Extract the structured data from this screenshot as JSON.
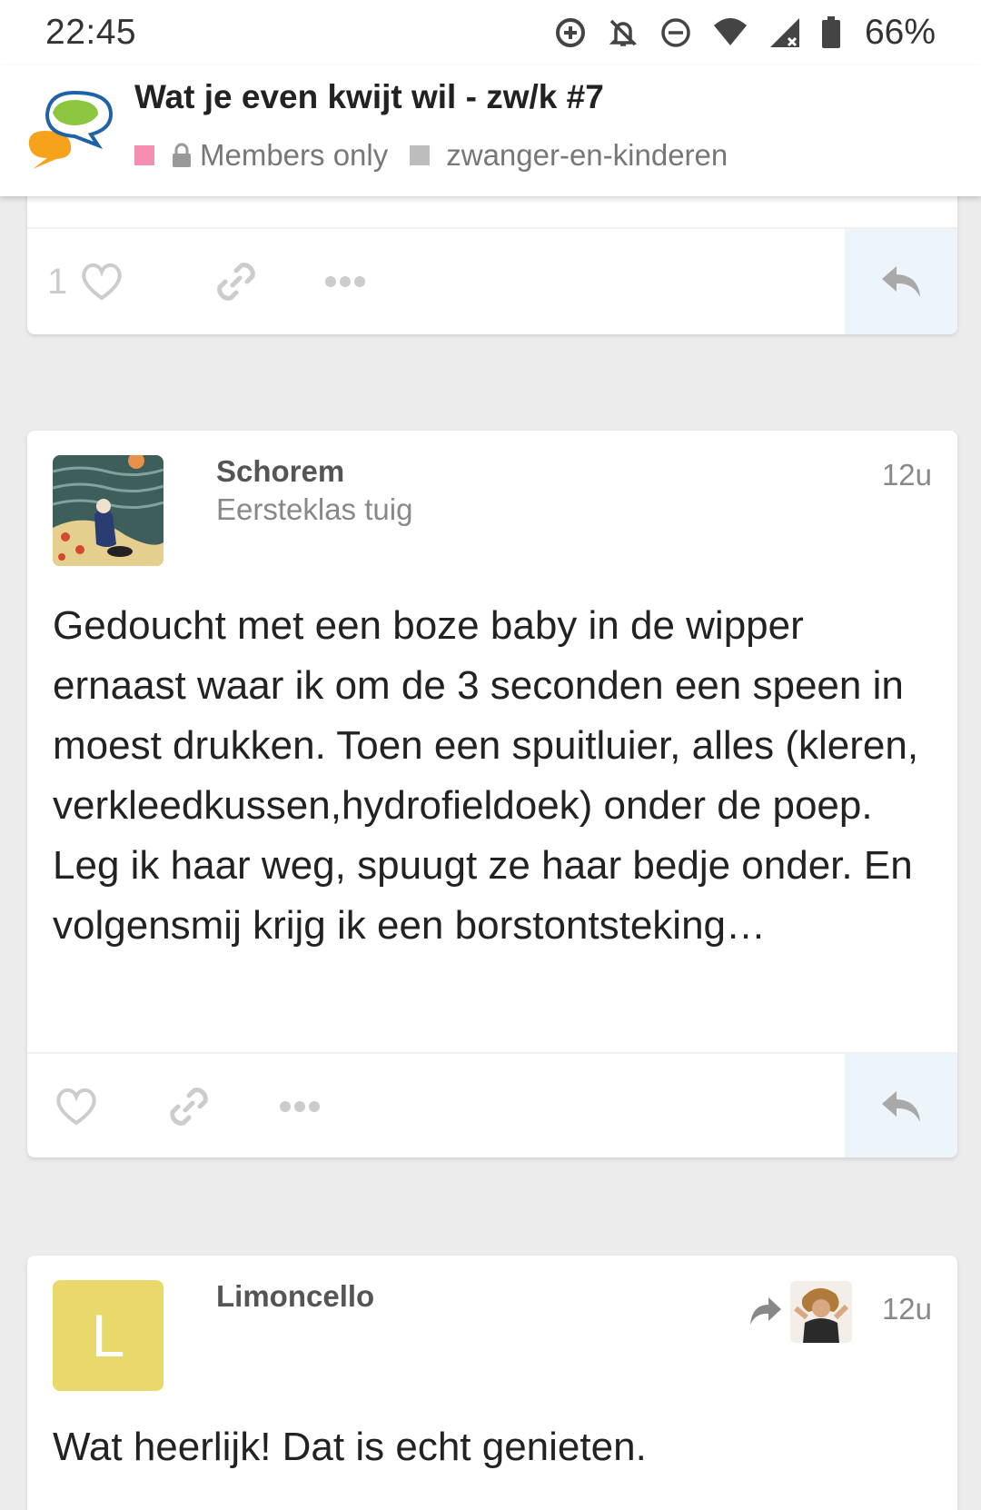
{
  "status_bar": {
    "time": "22:45",
    "battery": "66%",
    "icons": [
      "data-saver-icon",
      "notifications-off-icon",
      "do-not-disturb-icon",
      "wifi-icon",
      "signal-icon",
      "battery-icon"
    ]
  },
  "topic": {
    "title": "Wat je even kwijt wil - zw/k #7",
    "category_parent": "Members only",
    "category_child": "zwanger-en-kinderen",
    "colors": {
      "parent": "#f48fb1",
      "child": "#bdbdbd"
    }
  },
  "posts": [
    {
      "like_count": "1"
    },
    {
      "username": "Schorem",
      "user_title": "Eersteklas tuig",
      "time": "12u",
      "body": "Gedoucht met een boze baby in de wipper ernaast waar ik om de 3 seconden een speen in moest drukken. Toen een spuitluier, alles (kleren, verkleedkussen,hydrofieldoek) onder de poep. Leg ik haar weg, spuugt ze haar bedje onder. En volgensmij krijg ik een borstontsteking…"
    },
    {
      "username": "Limoncello",
      "avatar_letter": "L",
      "avatar_color": "#e8d96a",
      "time": "12u",
      "body": "Wat heerlijk! Dat is echt genieten."
    }
  ]
}
